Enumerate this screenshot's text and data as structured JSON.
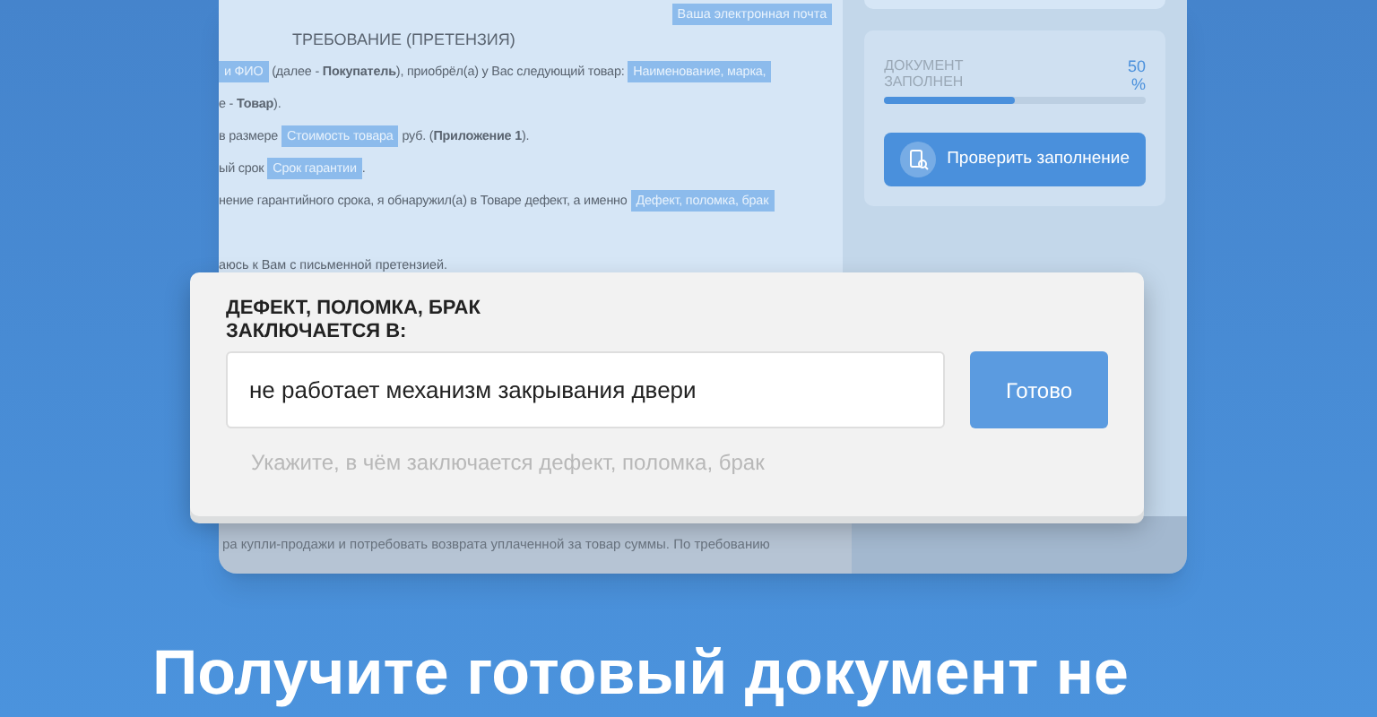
{
  "document": {
    "email_field": "Ваша электронная почта",
    "heading": "ТРЕБОВАНИЕ (ПРЕТЕНЗИЯ)",
    "lines": [
      [
        {
          "kind": "highlight",
          "text": "и ФИО"
        },
        {
          "kind": "text",
          "text": " (далее - **Покупатель**), приобрёл(а) у Вас следующий товар: "
        },
        {
          "kind": "highlight",
          "text": "Наименование, марка,"
        }
      ],
      [
        {
          "kind": "text",
          "text": "е - **Товар**)."
        }
      ],
      [
        {
          "kind": "text",
          "text": "в размере "
        },
        {
          "kind": "highlight",
          "text": "Стоимость товара"
        },
        {
          "kind": "text",
          "text": " руб. (**Приложение 1**)."
        }
      ],
      [
        {
          "kind": "text",
          "text": "ый срок "
        },
        {
          "kind": "highlight",
          "text": "Срок гарантии"
        },
        {
          "kind": "text",
          "text": "."
        }
      ],
      [
        {
          "kind": "text",
          "text": "нение гарантийного срока, я обнаружил(а) в Товаре дефект, а именно "
        },
        {
          "kind": "highlight",
          "text": "Дефект, поломка, брак"
        }
      ]
    ],
    "closing_line": "аюсь к Вам с письменной претензией.",
    "lower_line": "ра купли-продажи и потребовать возврата уплаченной за товар суммы. По требованию"
  },
  "sidebar": {
    "progress_label": "ДОКУМЕНТ ЗАПОЛНЕН",
    "progress_value": "50 %",
    "level": 0.5,
    "check_button": "Проверить заполнение"
  },
  "dialog": {
    "title": "ДЕФЕКТ, ПОЛОМКА, БРАК ЗАКЛЮЧАЕТСЯ В:",
    "value": "не работает механизм закрывания двери",
    "done_button": "Готово",
    "hint": "Укажите, в чём заключается дефект, поломка, брак"
  },
  "headline": "Получите готовый документ не"
}
